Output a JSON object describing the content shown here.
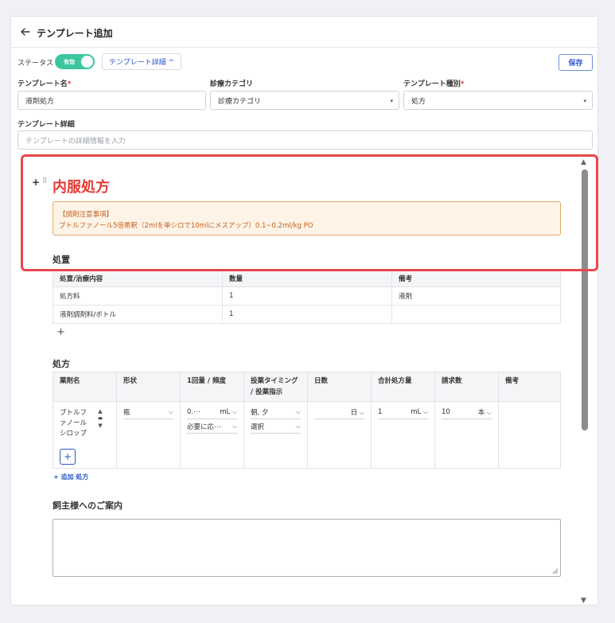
{
  "header": {
    "title": "テンプレート追加"
  },
  "status": {
    "label": "ステータス",
    "toggle_label": "有効",
    "detail_button": "テンプレート詳細 ^",
    "save_label": "保存"
  },
  "fields": {
    "name_label": "テンプレート名",
    "name_value": "液剤処方",
    "category_label": "診療カテゴリ",
    "category_value": "診療カテゴリ",
    "type_label": "テンプレート種別",
    "type_value": "処方",
    "detail_label": "テンプレート詳細",
    "detail_placeholder": "テンプレートの詳細情報を入力",
    "required_mark": "*"
  },
  "template": {
    "title": "内服処方",
    "notice_title": "【調剤注意事項】",
    "notice_body": "ブトルファノール5倍希釈（2mlを単シロで10mlにメスアップ）0.1~0.2ml/kg PO"
  },
  "procedure": {
    "title": "処置",
    "headers": [
      "処置/治療内容",
      "数量",
      "備考"
    ],
    "rows": [
      [
        "処方料",
        "1",
        "液剤"
      ],
      [
        "液剤調剤料/ボトル",
        "1",
        ""
      ]
    ]
  },
  "prescription": {
    "title": "処方",
    "headers": [
      "薬剤名",
      "形状",
      "1回量 / 頻度",
      "投薬タイミング / 投薬指示",
      "日数",
      "合計処方量",
      "請求数",
      "備考"
    ],
    "row": {
      "drug_name": "ブトルファノールシロップ",
      "form": "瓶",
      "dose": "0.⋯",
      "dose_unit": "mL",
      "frequency": "必要に応⋯",
      "timing": "朝, 夕",
      "instruction": "選択",
      "days": "",
      "days_unit": "日",
      "total": "1",
      "total_unit": "mL",
      "claim": "10",
      "claim_unit": "本",
      "note": ""
    },
    "add_label": "+ 追加 処方"
  },
  "owner_note": {
    "title": "飼主様へのご案内"
  }
}
